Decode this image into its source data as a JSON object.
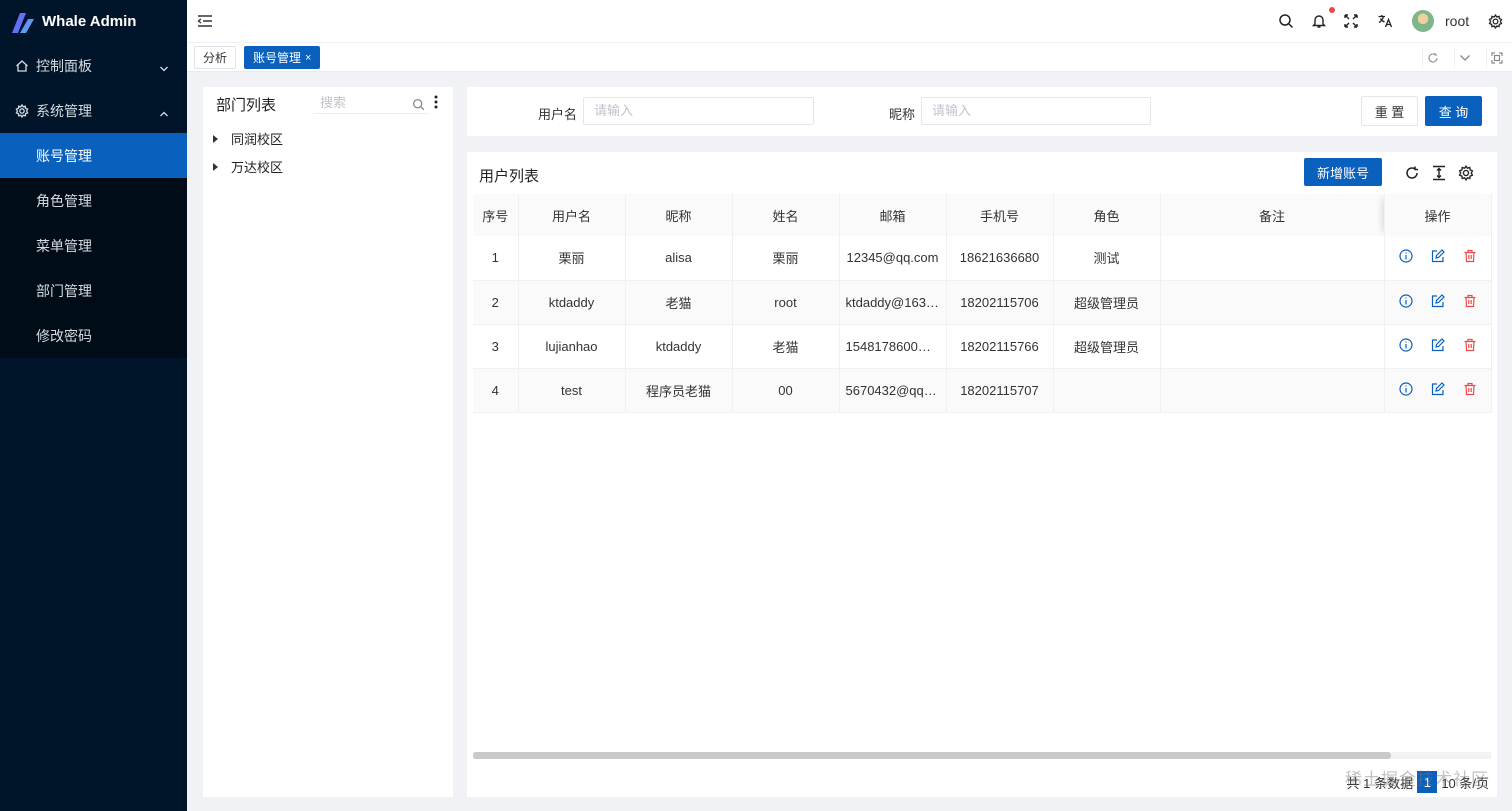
{
  "app": {
    "title": "Whale Admin"
  },
  "sidebar": {
    "groups": [
      {
        "label": "控制面板",
        "icon": "home-icon"
      },
      {
        "label": "系统管理",
        "icon": "gear-icon"
      }
    ],
    "items": [
      {
        "label": "账号管理"
      },
      {
        "label": "角色管理"
      },
      {
        "label": "菜单管理"
      },
      {
        "label": "部门管理"
      },
      {
        "label": "修改密码"
      }
    ]
  },
  "header": {
    "username": "root"
  },
  "tabs": [
    {
      "label": "分析"
    },
    {
      "label": "账号管理",
      "close": "×"
    }
  ],
  "dept": {
    "title": "部门列表",
    "search_placeholder": "搜索",
    "nodes": [
      {
        "label": "同润校区"
      },
      {
        "label": "万达校区"
      }
    ]
  },
  "search_form": {
    "username_label": "用户名",
    "username_placeholder": "请输入",
    "nickname_label": "昵称",
    "nickname_placeholder": "请输入",
    "reset_label": "重 置",
    "query_label": "查 询"
  },
  "user_list": {
    "title": "用户列表",
    "add_label": "新增账号",
    "columns": [
      "序号",
      "用户名",
      "昵称",
      "姓名",
      "邮箱",
      "手机号",
      "角色",
      "备注",
      "操作"
    ],
    "rows": [
      [
        "1",
        "栗丽",
        "alisa",
        "栗丽",
        "12345@qq.com",
        "18621636680",
        "测试",
        ""
      ],
      [
        "2",
        "ktdaddy",
        "老猫",
        "root",
        "ktdaddy@163....",
        "18202115706",
        "超级管理员",
        ""
      ],
      [
        "3",
        "lujianhao",
        "ktdaddy",
        "老猫",
        "1548178600@...",
        "18202115766",
        "超级管理员",
        ""
      ],
      [
        "4",
        "test",
        "程序员老猫",
        "00",
        "5670432@qq.c...",
        "18202115707",
        "",
        ""
      ]
    ]
  },
  "pager": {
    "prefix": "共 1",
    "unit": "条数据",
    "page": "1",
    "suffix": "10 条/页"
  },
  "watermark": "稀土掘金技术社区",
  "colors": {
    "primary": "#0960bd",
    "sidebar": "#001529",
    "danger": "#f04848"
  }
}
